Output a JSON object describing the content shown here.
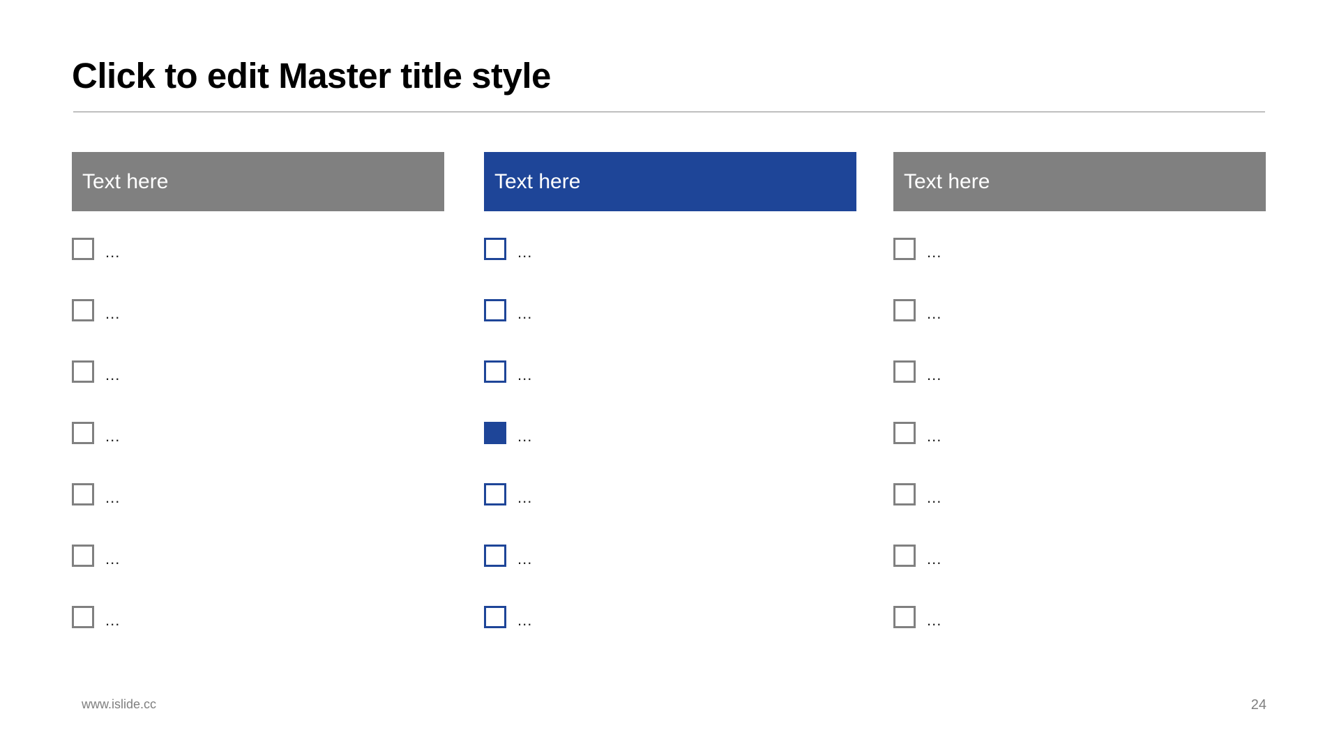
{
  "slide": {
    "title": "Click to edit Master title style",
    "background_color": "#ffffff",
    "title_color": "#000000",
    "rule_color": "#878787"
  },
  "theme": {
    "gray": "#808080",
    "blue": "#1e4598",
    "label_color": "#1a1a1a",
    "footer_color": "#7f7f7f",
    "header_text_color": "#ffffff"
  },
  "columns": [
    {
      "id": "column-1",
      "header_label": "Text here",
      "header_color": "#808080",
      "accent": "#808080",
      "items": [
        {
          "label": "...",
          "checked": false
        },
        {
          "label": "...",
          "checked": false
        },
        {
          "label": "...",
          "checked": false
        },
        {
          "label": "...",
          "checked": false
        },
        {
          "label": "...",
          "checked": false
        },
        {
          "label": "...",
          "checked": false
        },
        {
          "label": "...",
          "checked": false
        }
      ]
    },
    {
      "id": "column-2",
      "header_label": "Text here",
      "header_color": "#1e4598",
      "accent": "#1e4598",
      "items": [
        {
          "label": "...",
          "checked": false
        },
        {
          "label": "...",
          "checked": false
        },
        {
          "label": "...",
          "checked": false
        },
        {
          "label": "...",
          "checked": true
        },
        {
          "label": "...",
          "checked": false
        },
        {
          "label": "...",
          "checked": false
        },
        {
          "label": "...",
          "checked": false
        }
      ]
    },
    {
      "id": "column-3",
      "header_label": "Text here",
      "header_color": "#808080",
      "accent": "#808080",
      "items": [
        {
          "label": "...",
          "checked": false
        },
        {
          "label": "...",
          "checked": false
        },
        {
          "label": "...",
          "checked": false
        },
        {
          "label": "...",
          "checked": false
        },
        {
          "label": "...",
          "checked": false
        },
        {
          "label": "...",
          "checked": false
        },
        {
          "label": "...",
          "checked": false
        }
      ]
    }
  ],
  "footer": {
    "url": "www.islide.cc",
    "page_number": "24"
  }
}
